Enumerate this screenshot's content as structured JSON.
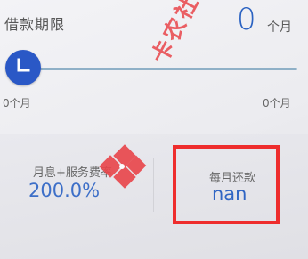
{
  "loan_term": {
    "label": "借款期限",
    "value": "0",
    "unit": "个月",
    "min_label": "0个月",
    "max_label": "0个月",
    "slider_level": 0
  },
  "rate": {
    "label": "月息+服务费率",
    "value": "200.0%"
  },
  "monthly_repayment": {
    "label": "每月还款",
    "value": "nan"
  },
  "watermark": {
    "text": "卡农社区"
  },
  "colors": {
    "accent": "#2a58c6",
    "highlight_box": "#ee2d2d",
    "watermark": "#e9454a"
  },
  "icons": {
    "slider_thumb": "clock-icon",
    "watermark_logo": "kanong-logo-icon"
  }
}
